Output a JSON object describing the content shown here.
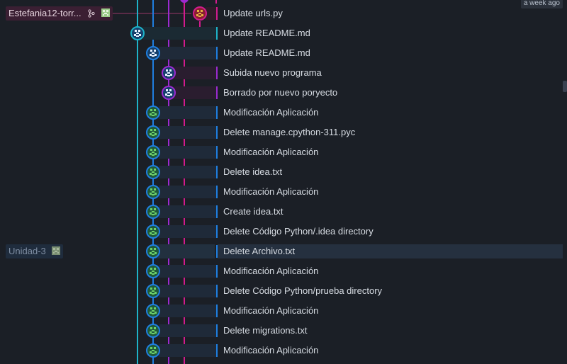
{
  "colors": {
    "background": "#1b1f26",
    "lane_cyan": "#1eb3c9",
    "lane_blue": "#1f7fe0",
    "lane_purple": "#9b2ad0",
    "lane_magenta": "#d21b8e",
    "avatar_green": "#58b85a",
    "avatar_blue_white": "#cfe5ff",
    "avatar_orange": "#d8a22a"
  },
  "timestamp": "a week ago",
  "branches": {
    "main": {
      "label": "Estefania12-torr...",
      "icon": "fork-icon"
    },
    "unidad": {
      "label": "Unidad-3"
    }
  },
  "commits": [
    {
      "message": "Update urls.py",
      "lane": "magenta",
      "avatar": "orange"
    },
    {
      "message": "Update README.md",
      "lane": "cyan",
      "avatar": "light"
    },
    {
      "message": "Update README.md",
      "lane": "blue",
      "avatar": "light"
    },
    {
      "message": "Subida nuevo programa",
      "lane": "purple",
      "avatar": "light"
    },
    {
      "message": "Borrado por nuevo poryecto",
      "lane": "purple",
      "avatar": "light"
    },
    {
      "message": "Modificación Aplicación",
      "lane": "blue",
      "avatar": "green"
    },
    {
      "message": "Delete manage.cpython-311.pyc",
      "lane": "blue",
      "avatar": "green"
    },
    {
      "message": "Modificación Aplicación",
      "lane": "blue",
      "avatar": "green"
    },
    {
      "message": "Delete idea.txt",
      "lane": "blue",
      "avatar": "green"
    },
    {
      "message": "Modificación Aplicación",
      "lane": "blue",
      "avatar": "green"
    },
    {
      "message": "Create idea.txt",
      "lane": "blue",
      "avatar": "green"
    },
    {
      "message": "Delete Código Python/.idea directory",
      "lane": "blue",
      "avatar": "green"
    },
    {
      "message": "Delete Archivo.txt",
      "lane": "blue",
      "avatar": "green"
    },
    {
      "message": "Modificación Aplicación",
      "lane": "blue",
      "avatar": "green"
    },
    {
      "message": "Delete Código Python/prueba directory",
      "lane": "blue",
      "avatar": "green"
    },
    {
      "message": "Modificación Aplicación",
      "lane": "blue",
      "avatar": "green"
    },
    {
      "message": "Delete migrations.txt",
      "lane": "blue",
      "avatar": "green"
    },
    {
      "message": "Modificación Aplicación",
      "lane": "blue",
      "avatar": "green"
    }
  ]
}
